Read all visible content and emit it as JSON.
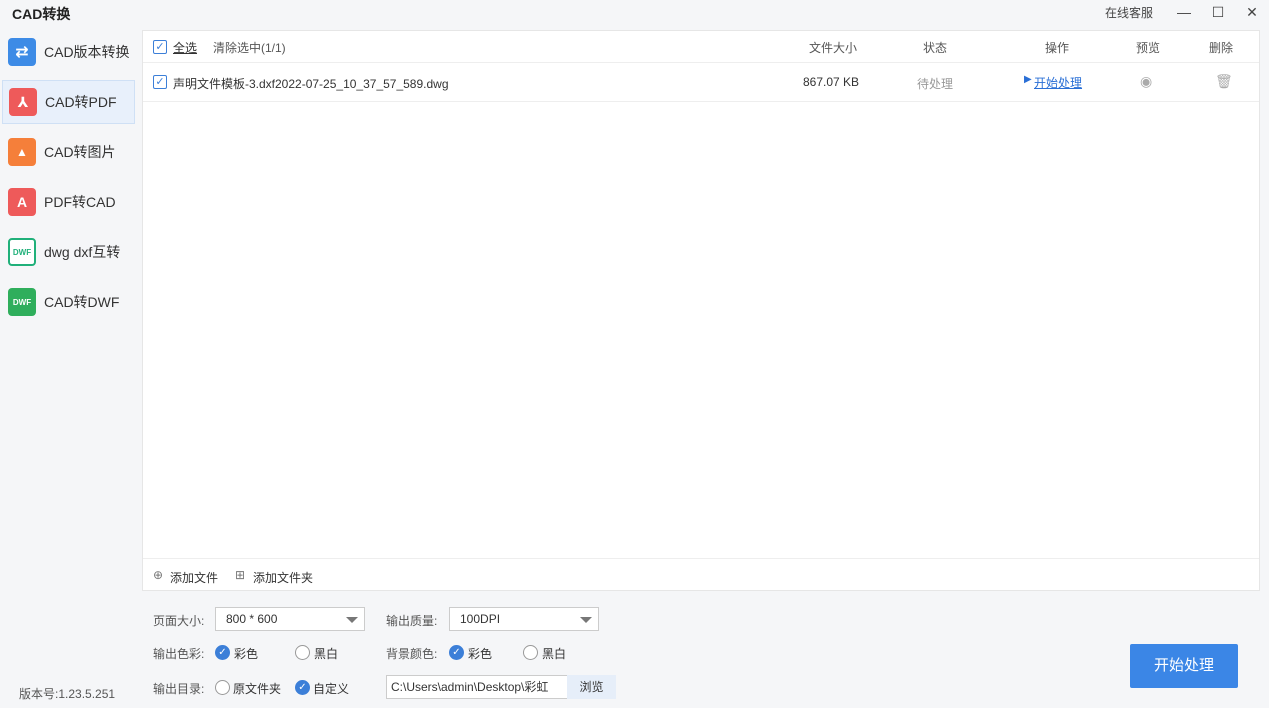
{
  "app": {
    "title": "CAD转换",
    "service": "在线客服",
    "minimize": "—",
    "maximize": "☐",
    "close": "✕"
  },
  "sidebar": {
    "items": [
      {
        "label": "CAD版本转换",
        "icon_text": "⇄",
        "color": "#3d8be6"
      },
      {
        "label": "CAD转PDF",
        "icon_text": "⅄",
        "color": "#ee5a5a"
      },
      {
        "label": "CAD转图片",
        "icon_text": "▲",
        "color": "#f57f3a"
      },
      {
        "label": "PDF转CAD",
        "icon_text": "A",
        "color": "#ee5a5a"
      },
      {
        "label": "dwg dxf互转",
        "icon_text": "DWF",
        "color": "#20b07a"
      },
      {
        "label": "CAD转DWF",
        "icon_text": "DWF",
        "color": "#2fae5c"
      }
    ],
    "selected": 1
  },
  "list": {
    "select_all": "全选",
    "clear_selection": "清除选中(1/1)",
    "columns": {
      "size": "文件大小",
      "status": "状态",
      "action": "操作",
      "preview": "预览",
      "delete": "删除"
    },
    "rows": [
      {
        "name": "声明文件模板-3.dxf2022-07-25_10_37_57_589.dwg",
        "size": "867.07 KB",
        "status": "待处理",
        "action": "开始处理"
      }
    ],
    "add_file": "添加文件",
    "add_folder": "添加文件夹"
  },
  "settings": {
    "page_size_label": "页面大小:",
    "page_size": "800 * 600",
    "quality_label": "输出质量:",
    "quality": "100DPI",
    "color_label": "输出色彩:",
    "color_opt1": "彩色",
    "color_opt2": "黑白",
    "bg_label": "背景颜色:",
    "bg_opt1": "彩色",
    "bg_opt2": "黑白",
    "dir_label": "输出目录:",
    "dir_opt1": "原文件夹",
    "dir_opt2": "自定义",
    "path": "C:\\Users\\admin\\Desktop\\彩虹",
    "browse": "浏览"
  },
  "start_button": "开始处理",
  "version": "版本号:1.23.5.251"
}
